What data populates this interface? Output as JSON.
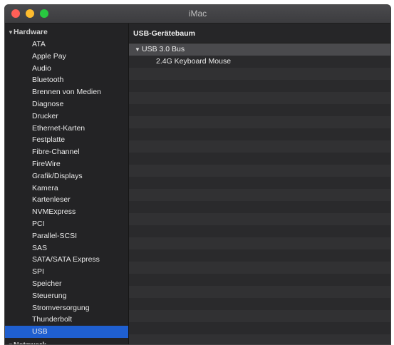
{
  "window": {
    "title": "iMac"
  },
  "sidebar": {
    "group_hardware": "Hardware",
    "items": [
      "ATA",
      "Apple Pay",
      "Audio",
      "Bluetooth",
      "Brennen von Medien",
      "Diagnose",
      "Drucker",
      "Ethernet-Karten",
      "Festplatte",
      "Fibre-Channel",
      "FireWire",
      "Grafik/Displays",
      "Kamera",
      "Kartenleser",
      "NVMExpress",
      "PCI",
      "Parallel-SCSI",
      "SAS",
      "SATA/SATA Express",
      "SPI",
      "Speicher",
      "Steuerung",
      "Stromversorgung",
      "Thunderbolt",
      "USB"
    ],
    "selected": "USB",
    "group_network": "Netzwerk"
  },
  "main": {
    "header": "USB-Gerätebaum",
    "tree": [
      {
        "label": "USB 3.0 Bus",
        "level": 0,
        "expanded": true
      },
      {
        "label": "2.4G Keyboard Mouse",
        "level": 1
      }
    ]
  },
  "colors": {
    "selection": "#1f5fd0",
    "close": "#ff5f57",
    "minimize": "#febc2e",
    "zoom": "#28c840"
  }
}
